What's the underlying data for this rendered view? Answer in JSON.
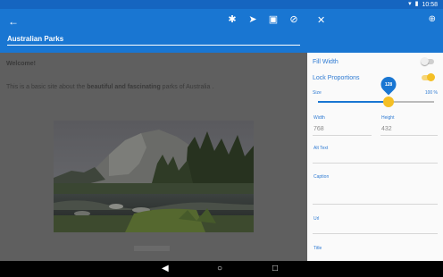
{
  "status_bar": {
    "time": "10:58",
    "wifi_icon": "wifi-icon",
    "battery_icon": "battery-icon"
  },
  "editor": {
    "title_value": "Australian Parks",
    "toolbar": {
      "back_icon": "arrow-back-icon",
      "settings_icon": "gear-icon",
      "send_icon": "send-icon",
      "save_icon": "save-icon",
      "block_icon": "block-icon"
    },
    "content": {
      "welcome": "Welcome!",
      "intro_pre": "This is a basic site about the ",
      "intro_bold": "beautiful and fascinating",
      "intro_post": " parks of Australia ."
    }
  },
  "panel": {
    "close_icon": "close-icon",
    "add_user_icon": "add-user-icon",
    "fill_width": {
      "label": "Fill Width",
      "on": false
    },
    "lock_proportions": {
      "label": "Lock Proportions",
      "on": true
    },
    "size": {
      "label": "Size",
      "max_label": "100 %",
      "value": 128,
      "fraction": 0.61
    },
    "width": {
      "label": "Width",
      "value": "768"
    },
    "height": {
      "label": "Height",
      "value": "432"
    },
    "alt_text": {
      "label": "Alt Text"
    },
    "caption": {
      "label": "Caption"
    },
    "url": {
      "label": "Url"
    },
    "title": {
      "label": "Title"
    }
  },
  "navbar": {
    "back_icon": "nav-back-icon",
    "home_icon": "nav-home-icon",
    "recents_icon": "nav-recents-icon"
  },
  "colors": {
    "primary": "#1976d2",
    "accent": "#f4bf25",
    "overlay": "#5f5f5f"
  }
}
